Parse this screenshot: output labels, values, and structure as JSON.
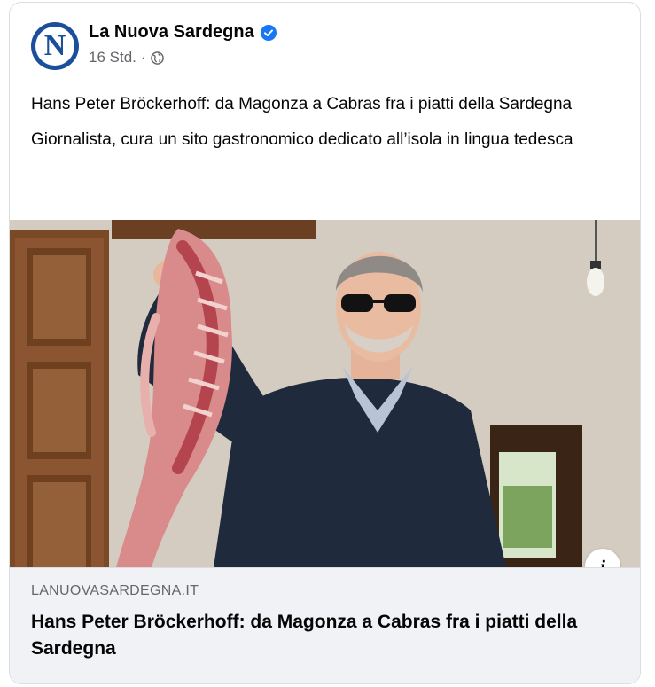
{
  "post": {
    "page_name": "La Nuova Sardegna",
    "avatar_letter": "N",
    "verified_icon": "verified-badge-icon",
    "timestamp": "16 Std.",
    "separator": "·",
    "audience_icon": "globe-icon",
    "text_paragraphs": [
      "Hans Peter Bröckerhoff: da Magonza a Cabras fra i piatti della Sardegna",
      "Giornalista, cura un sito gastronomico dedicato all’isola in lingua tedesca"
    ]
  },
  "photo": {
    "icon": "info-icon",
    "info_glyph": "i"
  },
  "link_preview": {
    "domain": "LANUOVASARDEGNA.IT",
    "title": "Hans Peter Bröckerhoff: da Magonza a Cabras fra i piatti della Sardegna"
  },
  "colors": {
    "brand_blue": "#1b4f9b",
    "verified_blue": "#1877f2",
    "secondary_text": "#65676b",
    "preview_bg": "#f0f2f5"
  }
}
